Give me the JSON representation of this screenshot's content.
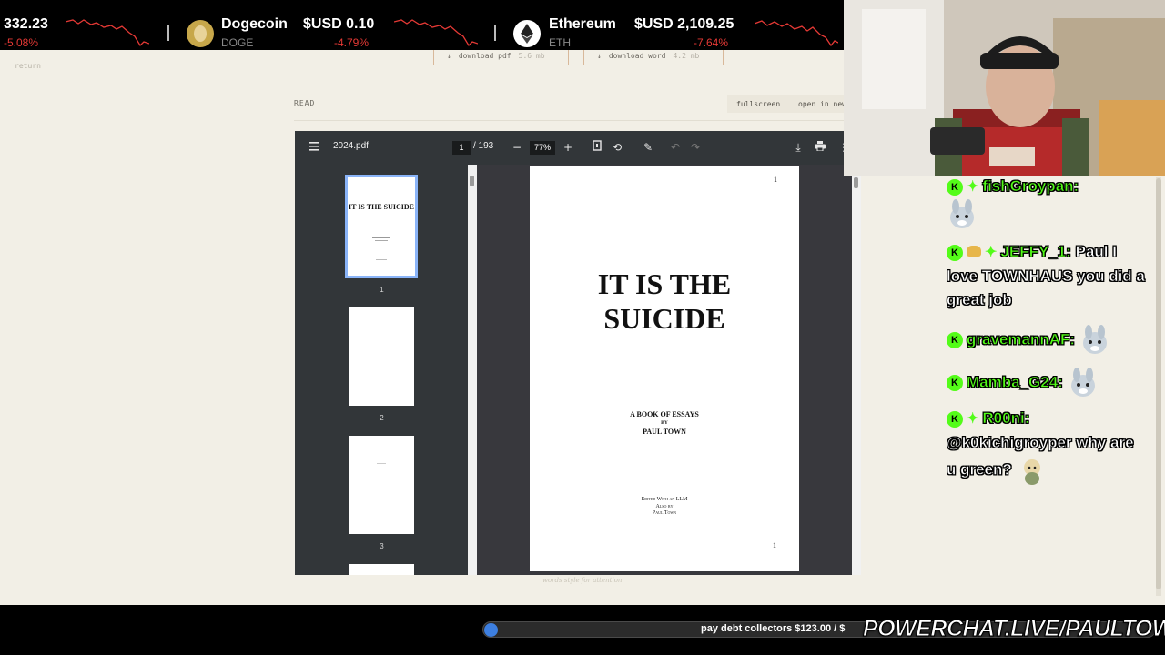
{
  "ticker": {
    "items": [
      {
        "name": "",
        "symbol": "",
        "price": "332.23",
        "change": "-5.08%"
      },
      {
        "name": "Dogecoin",
        "symbol": "DOGE",
        "price": "$USD 0.10",
        "change": "-4.79%"
      },
      {
        "name": "Ethereum",
        "symbol": "ETH",
        "price": "$USD 2,109.25",
        "change": "-7.64%"
      }
    ],
    "down_color": "#e53935"
  },
  "page": {
    "return_link": "return",
    "downloads": [
      {
        "label": "download pdf",
        "size": "5.6 mb"
      },
      {
        "label": "download word",
        "size": "4.2 mb"
      }
    ],
    "section_label": "READ",
    "fullscreen_label": "fullscreen",
    "open_new_label": "open in new",
    "footnote": "words style for attention"
  },
  "viewer": {
    "filename": "2024.pdf",
    "current_page": "1",
    "total_pages": "/ 193",
    "zoom": "77%",
    "thumbnail_numbers": [
      "1",
      "2",
      "3"
    ],
    "thumb_title": "IT IS THE SUICIDE",
    "page": {
      "page_number_top": "1",
      "title_line1": "IT IS THE",
      "title_line2": "SUICIDE",
      "subtitle": "A BOOK OF ESSAYS",
      "by": "BY",
      "author": "PAUL TOWN",
      "edited": "Edited With an LLM",
      "also_by": "Also by",
      "also_author": "Paul Town",
      "page_number_bottom": "1"
    }
  },
  "chat": {
    "messages": [
      {
        "user": "fishGroypan:",
        "text": ""
      },
      {
        "user": "JEFFY_1:",
        "text": "Paul I love TOWNHAUS you did a great job"
      },
      {
        "user": "gravemannAF:",
        "text": ""
      },
      {
        "user": "Mamba_G24:",
        "text": ""
      },
      {
        "user": "R00ni:",
        "text": "@k0kichigroyper why are u green?"
      }
    ],
    "username_color": "#53fc18"
  },
  "overlay": {
    "powerchat_text": "pay debt collectors $123.00 / $",
    "brand": "POWERCHAT.LIVE/PAULTOWN"
  },
  "icons": [
    "menu-icon",
    "fit-page-icon",
    "rotate-icon",
    "annotate-icon",
    "undo-icon",
    "redo-icon",
    "download-icon",
    "print-icon",
    "more-icon",
    "dogecoin-icon",
    "ethereum-icon",
    "kick-badge-icon"
  ]
}
